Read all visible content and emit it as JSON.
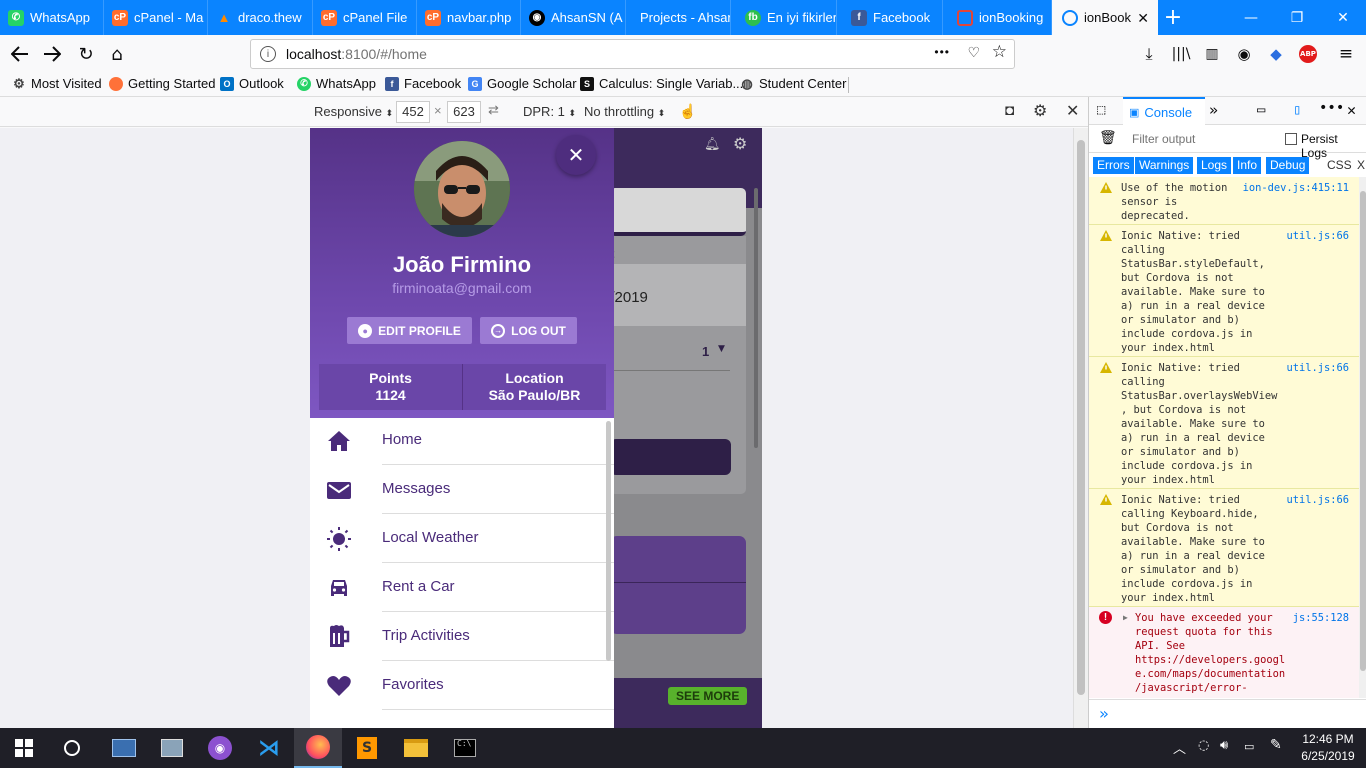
{
  "browser": {
    "tabs": [
      {
        "title": "WhatsApp",
        "icon": "whatsapp-icon",
        "color": "#25d366"
      },
      {
        "title": "cPanel - Ma",
        "icon": "cpanel-icon",
        "color": "#ff6c2c"
      },
      {
        "title": "draco.thew",
        "icon": "draco-icon",
        "color": "#ff8a00"
      },
      {
        "title": "cPanel File",
        "icon": "cpanel-icon",
        "color": "#ff6c2c"
      },
      {
        "title": "navbar.php",
        "icon": "cpanel-icon",
        "color": "#ff6c2c"
      },
      {
        "title": "AhsanSN (A",
        "icon": "github-icon",
        "color": "#000000"
      },
      {
        "title": "Projects - Ahsar",
        "icon": "",
        "color": ""
      },
      {
        "title": "En iyi fikirler",
        "icon": "fb-green-icon",
        "color": "#2dbf4e"
      },
      {
        "title": "Facebook",
        "icon": "facebook-icon",
        "color": "#3b5998"
      },
      {
        "title": "ionBooking",
        "icon": "ion-icon",
        "color": "#e0453a"
      },
      {
        "title": "ionBook",
        "icon": "ion-icon",
        "color": "#0a84ff"
      }
    ],
    "url_host": "localhost",
    "url_rest": ":8100/#/home",
    "url_more": "•••",
    "bookmarks": [
      {
        "label": "Most Visited",
        "icon": "gear-icon"
      },
      {
        "label": "Getting Started",
        "icon": "firefox-icon"
      },
      {
        "label": "Outlook",
        "icon": "outlook-icon"
      },
      {
        "label": "WhatsApp",
        "icon": "whatsapp-icon"
      },
      {
        "label": "Facebook",
        "icon": "facebook-icon"
      },
      {
        "label": "Google Scholar",
        "icon": "scholar-icon"
      },
      {
        "label": "Calculus: Single Variab...",
        "icon": "s-icon"
      },
      {
        "label": "Student Center",
        "icon": "globe-icon"
      }
    ],
    "accent": "#0a84ff"
  },
  "rdm": {
    "device": "Responsive",
    "width": "452",
    "times": "×",
    "height": "623",
    "dpr": "DPR: 1",
    "throttle": "No throttling"
  },
  "app": {
    "profile": {
      "name": "João Firmino",
      "email": "firminoata@gmail.com",
      "edit_label": "EDIT PROFILE",
      "logout_label": "LOG OUT",
      "stats": [
        {
          "label": "Points",
          "value": "1124"
        },
        {
          "label": "Location",
          "value": "São Paulo/BR"
        }
      ]
    },
    "menu": [
      {
        "label": "Home",
        "icon": "home-icon"
      },
      {
        "label": "Messages",
        "icon": "mail-icon"
      },
      {
        "label": "Local Weather",
        "icon": "sun-icon"
      },
      {
        "label": "Rent a Car",
        "icon": "car-icon"
      },
      {
        "label": "Trip Activities",
        "icon": "beer-icon"
      },
      {
        "label": "Favorites",
        "icon": "heart-icon"
      }
    ],
    "background": {
      "frag_t": "t",
      "date": "5/2019",
      "qty": "1",
      "see_more": "SEE MORE"
    },
    "colors": {
      "primary": "#553287",
      "accent": "#7e57c2",
      "label": "#4a2b7a",
      "see_more": "#58b22c"
    }
  },
  "devtools": {
    "tab": "Console",
    "filter_placeholder": "Filter output",
    "persist": "Persist Logs",
    "filters": [
      "Errors",
      "Warnings",
      "Logs",
      "Info",
      "Debug",
      "CSS",
      "X"
    ],
    "messages": [
      {
        "type": "warn",
        "text": "Use of the motion\nsensor is\ndeprecated.",
        "source": "ion-dev.js:415:11"
      },
      {
        "type": "warn",
        "text": "Ionic Native: tried\ncalling\nStatusBar.styleDefault,\nbut Cordova is not\navailable. Make sure to\na) run in a real device\nor simulator and b)\ninclude cordova.js in\nyour index.html",
        "source": "util.js:66"
      },
      {
        "type": "warn",
        "text": "Ionic Native: tried\ncalling\nStatusBar.overlaysWebView\n, but Cordova is not\navailable. Make sure to\na) run in a real device\nor simulator and b)\ninclude cordova.js in\nyour index.html",
        "source": "util.js:66"
      },
      {
        "type": "warn",
        "text": "Ionic Native: tried\ncalling Keyboard.hide,\nbut Cordova is not\navailable. Make sure to\na) run in a real device\nor simulator and b)\ninclude cordova.js in\nyour index.html",
        "source": "util.js:66"
      },
      {
        "type": "err",
        "text": "You have exceeded your\nrequest quota for this\nAPI. See\nhttps://developers.googl\ne.com/maps/documentation\n/javascript/error-",
        "source": "js:55:128"
      }
    ],
    "prompt": "»"
  },
  "taskbar": {
    "time": "12:46 PM",
    "date": "6/25/2019"
  }
}
